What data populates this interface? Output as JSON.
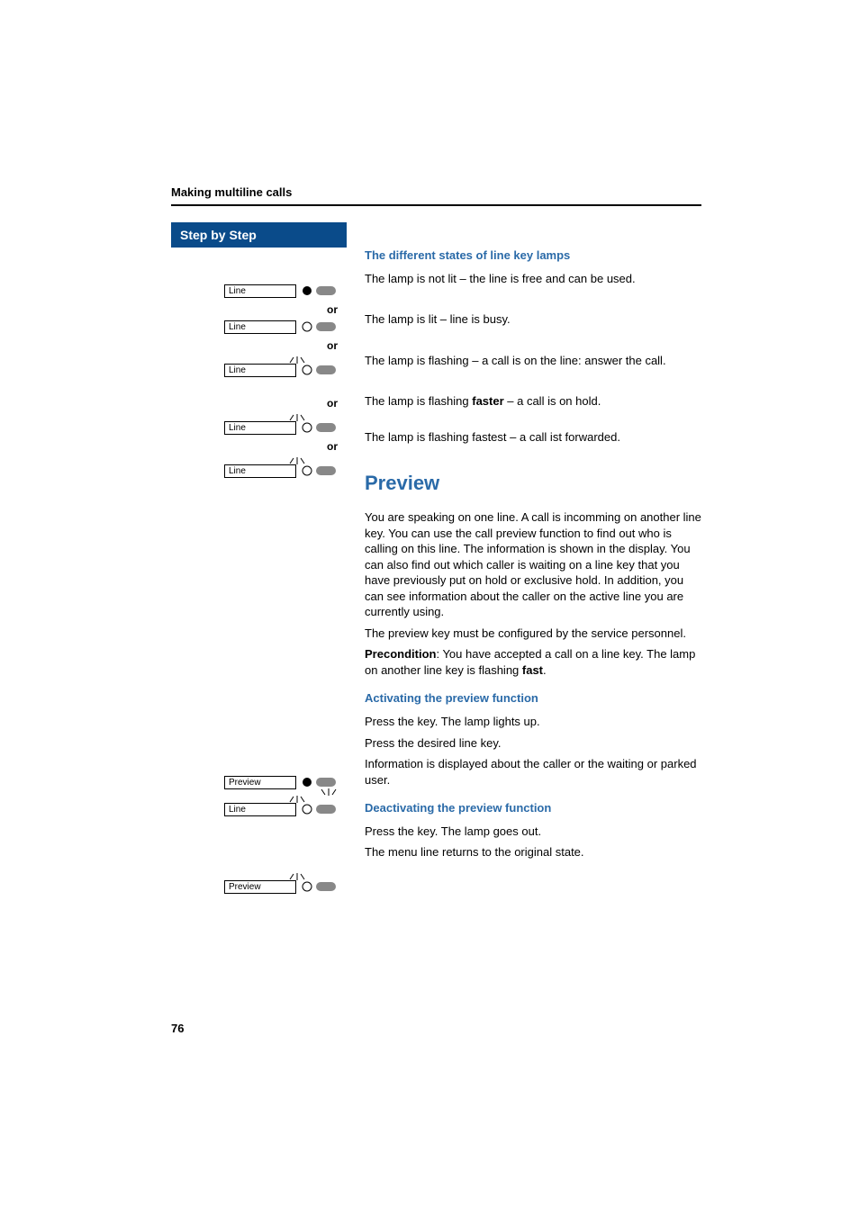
{
  "header": {
    "section": "Making multiline calls"
  },
  "sidebar": {
    "title": "Step by Step",
    "keys": {
      "line": "Line",
      "preview": "Preview"
    },
    "or": "or"
  },
  "content": {
    "states_heading": "The different states of line key lamps",
    "state_off": "The lamp is not lit – the line is free and can be used.",
    "state_lit": "The lamp is lit – line is busy.",
    "state_flash": "The lamp is flashing – a call is on the line: answer the call.",
    "state_faster_pre": "The lamp is flashing ",
    "state_faster_bold": "faster",
    "state_faster_post": " – a call is on hold.",
    "state_fastest": "The lamp is flashing fastest – a call ist forwarded.",
    "preview_heading": "Preview",
    "preview_body": "You are speaking on one line. A call is incomming on another line key. You can use the call preview function to find out who is calling on this line. The information is shown in the display. You can also find out which caller is waiting on a line key that you have previously put on hold or exclusive hold. In addition, you can see information about the caller on the active line you are currently using.",
    "preview_service": "The preview key must be configured by the service personnel.",
    "precondition_label": "Precondition",
    "precondition_text": ": You have accepted a call on a line key. The lamp on another line key is flashing ",
    "precondition_bold": "fast",
    "precondition_end": ".",
    "activate_heading": "Activating the preview function",
    "activate_press": "Press the key. The lamp lights up.",
    "activate_line": "Press the desired line key.",
    "activate_info": "Information is displayed about the caller or the waiting or parked user.",
    "deactivate_heading": "Deactivating the preview function",
    "deactivate_press": "Press the key. The lamp goes out.",
    "deactivate_menu": "The menu line returns to the original state."
  },
  "footer": {
    "page": "76"
  }
}
